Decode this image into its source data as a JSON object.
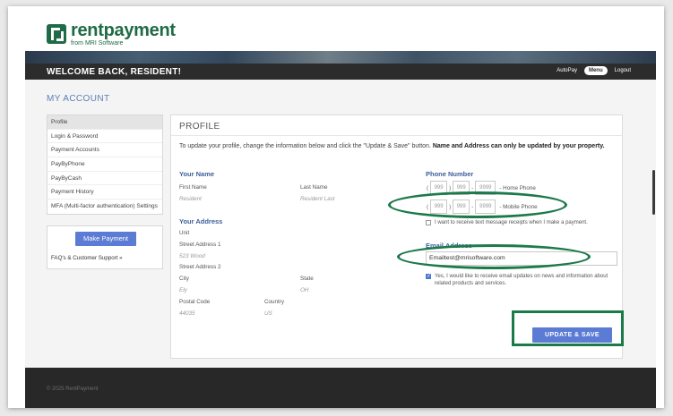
{
  "header": {
    "logo_name": "rentpayment",
    "logo_sub": "from MRI Software",
    "welcome": "WELCOME BACK, RESIDENT!",
    "nav": {
      "autopay": "AutoPay",
      "menu": "Menu",
      "logout": "Logout"
    }
  },
  "page": {
    "title": "MY ACCOUNT"
  },
  "sidebar": {
    "items": [
      {
        "label": "Profile"
      },
      {
        "label": "Login & Password"
      },
      {
        "label": "Payment Accounts"
      },
      {
        "label": "PayByPhone"
      },
      {
        "label": "PayByCash"
      },
      {
        "label": "Payment History"
      },
      {
        "label": "MFA (Multi-factor authentication) Settings"
      }
    ],
    "make_payment": "Make Payment",
    "faq": "FAQ's & Customer Support »"
  },
  "profile": {
    "title": "PROFILE",
    "desc_normal": "To update your profile, change the information below and click the \"Update & Save\" button. ",
    "desc_bold": "Name and Address can only be updated by your property.",
    "name": {
      "section": "Your Name",
      "first_label": "First Name",
      "first_value": "Resident",
      "last_label": "Last Name",
      "last_value": "Resident Last"
    },
    "address": {
      "section": "Your Address",
      "unit_label": "Unit",
      "street1_label": "Street Address 1",
      "street1_value": "523 Wood",
      "street2_label": "Street Address 2",
      "city_label": "City",
      "city_value": "Ely",
      "state_label": "State",
      "state_value": "OH",
      "postal_label": "Postal Code",
      "postal_value": "44035",
      "country_label": "Country",
      "country_value": "US"
    },
    "phone": {
      "section": "Phone Number",
      "home": {
        "area": "999",
        "prefix": "999",
        "line": "9999",
        "type": "- Home Phone"
      },
      "mobile": {
        "area": "999",
        "prefix": "999",
        "line": "9999",
        "type": "- Mobile Phone"
      },
      "text_opt": "I want to receive text message receipts when I make a payment."
    },
    "email": {
      "section": "Email Address",
      "value": "Emailtest@mrisoftware.com",
      "opt": "Yes, I would like to receive email updates on news and information about related products and services."
    },
    "update_button": "UPDATE & SAVE"
  },
  "footer": {
    "text": "© 2025 RentPayment"
  },
  "colors": {
    "brand": "#1f6b46",
    "accent": "#5b7bd4",
    "annotation": "#1c7a4a"
  }
}
